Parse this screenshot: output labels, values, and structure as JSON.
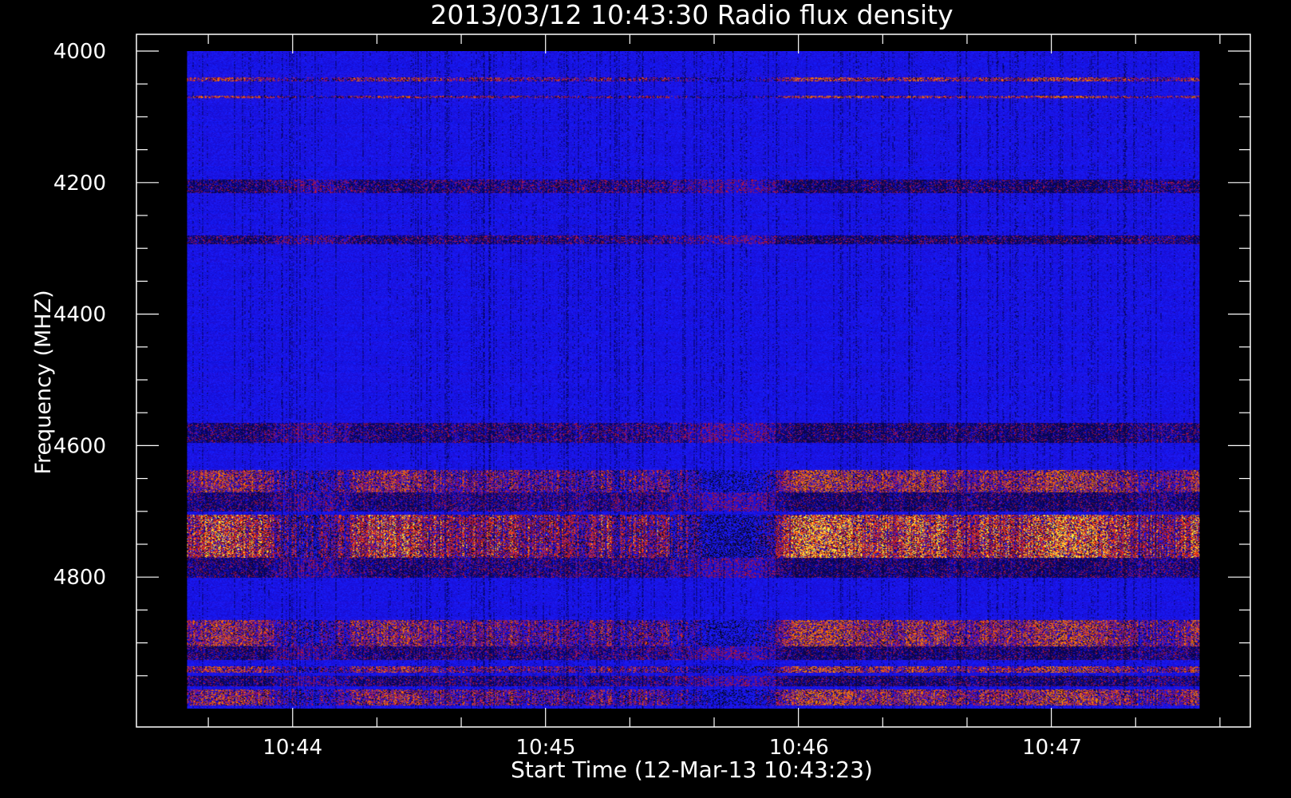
{
  "chart_data": {
    "type": "heatmap",
    "title": "2013/03/12 10:43:30 Radio flux density",
    "xlabel": "Start Time (12-Mar-13 10:43:23)",
    "ylabel": "Frequency (MHZ)",
    "x_tick_labels": [
      "10:44",
      "10:45",
      "10:46",
      "10:47"
    ],
    "x_ticks_min_since_start": [
      0.617,
      1.617,
      2.617,
      3.617
    ],
    "x_data_range_min_since_start": [
      0.2,
      4.2
    ],
    "x_axis_range_min_since_start": [
      0.0,
      4.4
    ],
    "y_tick_labels": [
      "4000",
      "4200",
      "4400",
      "4600",
      "4800"
    ],
    "y_ticks": [
      4000,
      4200,
      4400,
      4600,
      4800
    ],
    "ylim": [
      4000,
      5000
    ],
    "y_data_range": [
      4000,
      5000
    ],
    "y_minor_step": 50,
    "x_minor_step_min": 0.333,
    "colormap": "black-blue-red-yellow",
    "colors": {
      "background": "#000000",
      "axes": "#ffffff",
      "low": "#000000",
      "mid": "#1a14ff",
      "high": "#e81a0a",
      "peak": "#ffff33"
    },
    "bands": [
      {
        "f1": 4040,
        "f2": 4045,
        "level": "high"
      },
      {
        "f1": 4067,
        "f2": 4071,
        "level": "high"
      },
      {
        "f1": 4195,
        "f2": 4215,
        "level": "dark"
      },
      {
        "f1": 4280,
        "f2": 4293,
        "level": "dark"
      },
      {
        "f1": 4565,
        "f2": 4595,
        "level": "dark"
      },
      {
        "f1": 4636,
        "f2": 4670,
        "level": "high"
      },
      {
        "f1": 4670,
        "f2": 4700,
        "level": "dark"
      },
      {
        "f1": 4705,
        "f2": 4770,
        "level": "peak"
      },
      {
        "f1": 4770,
        "f2": 4800,
        "level": "dark"
      },
      {
        "f1": 4865,
        "f2": 4905,
        "level": "high"
      },
      {
        "f1": 4905,
        "f2": 4925,
        "level": "dark"
      },
      {
        "f1": 4935,
        "f2": 4945,
        "level": "high"
      },
      {
        "f1": 4950,
        "f2": 4965,
        "level": "dark"
      },
      {
        "f1": 4970,
        "f2": 4995,
        "level": "high"
      }
    ]
  }
}
